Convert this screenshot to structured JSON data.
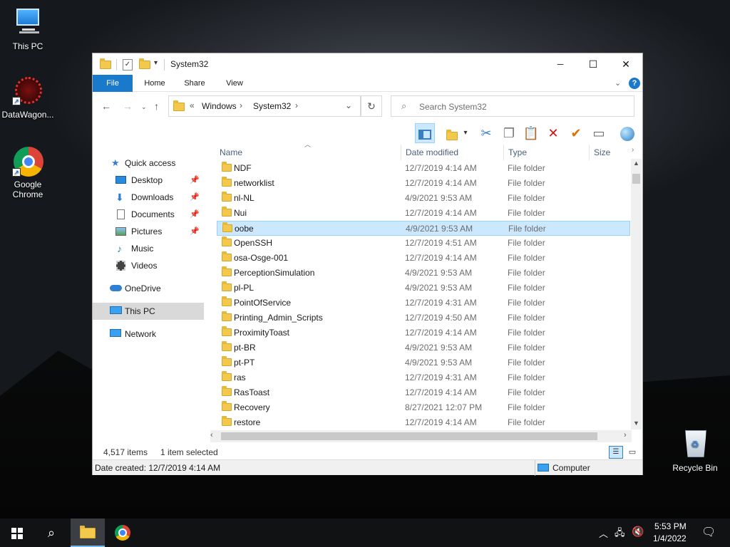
{
  "desktop": {
    "icons": [
      {
        "label": "This PC"
      },
      {
        "label": "DataWagon..."
      },
      {
        "label": "Google\nChrome"
      },
      {
        "label": "Recycle Bin"
      }
    ]
  },
  "window": {
    "title": "System32",
    "controls": {
      "minimize": "─",
      "maximize": "☐",
      "close": "✕"
    },
    "ribbon_tabs": [
      "File",
      "Home",
      "Share",
      "View"
    ],
    "address": {
      "prefix": "«",
      "parts": [
        "Windows",
        "System32"
      ],
      "sep": "›"
    },
    "search": {
      "placeholder": "Search System32"
    },
    "nav": [
      {
        "label": "Quick access"
      },
      {
        "label": "Desktop"
      },
      {
        "label": "Downloads"
      },
      {
        "label": "Documents"
      },
      {
        "label": "Pictures"
      },
      {
        "label": "Music"
      },
      {
        "label": "Videos"
      },
      {
        "label": "OneDrive"
      },
      {
        "label": "This PC"
      },
      {
        "label": "Network"
      }
    ],
    "columns": [
      "Name",
      "Date modified",
      "Type",
      "Size"
    ],
    "files": [
      {
        "name": "NDF",
        "date": "12/7/2019 4:14 AM",
        "type": "File folder"
      },
      {
        "name": "networklist",
        "date": "12/7/2019 4:14 AM",
        "type": "File folder"
      },
      {
        "name": "nl-NL",
        "date": "4/9/2021 9:53 AM",
        "type": "File folder"
      },
      {
        "name": "Nui",
        "date": "12/7/2019 4:14 AM",
        "type": "File folder"
      },
      {
        "name": "oobe",
        "date": "4/9/2021 9:53 AM",
        "type": "File folder"
      },
      {
        "name": "OpenSSH",
        "date": "12/7/2019 4:51 AM",
        "type": "File folder"
      },
      {
        "name": "osa-Osge-001",
        "date": "12/7/2019 4:14 AM",
        "type": "File folder"
      },
      {
        "name": "PerceptionSimulation",
        "date": "4/9/2021 9:53 AM",
        "type": "File folder"
      },
      {
        "name": "pl-PL",
        "date": "4/9/2021 9:53 AM",
        "type": "File folder"
      },
      {
        "name": "PointOfService",
        "date": "12/7/2019 4:31 AM",
        "type": "File folder"
      },
      {
        "name": "Printing_Admin_Scripts",
        "date": "12/7/2019 4:50 AM",
        "type": "File folder"
      },
      {
        "name": "ProximityToast",
        "date": "12/7/2019 4:14 AM",
        "type": "File folder"
      },
      {
        "name": "pt-BR",
        "date": "4/9/2021 9:53 AM",
        "type": "File folder"
      },
      {
        "name": "pt-PT",
        "date": "4/9/2021 9:53 AM",
        "type": "File folder"
      },
      {
        "name": "ras",
        "date": "12/7/2019 4:31 AM",
        "type": "File folder"
      },
      {
        "name": "RasToast",
        "date": "12/7/2019 4:14 AM",
        "type": "File folder"
      },
      {
        "name": "Recovery",
        "date": "8/27/2021 12:07 PM",
        "type": "File folder"
      },
      {
        "name": "restore",
        "date": "12/7/2019 4:14 AM",
        "type": "File folder"
      }
    ],
    "selected_index": 4,
    "status": {
      "count": "4,517 items",
      "selection": "1 item selected"
    },
    "details": {
      "created": "Date created: 12/7/2019 4:14 AM",
      "location": "Computer"
    }
  },
  "taskbar": {
    "time": "5:53 PM",
    "date": "1/4/2022"
  },
  "colors": {
    "accent": "#1979ca",
    "selection": "#cce8ff",
    "folder": "#f2c94c"
  }
}
